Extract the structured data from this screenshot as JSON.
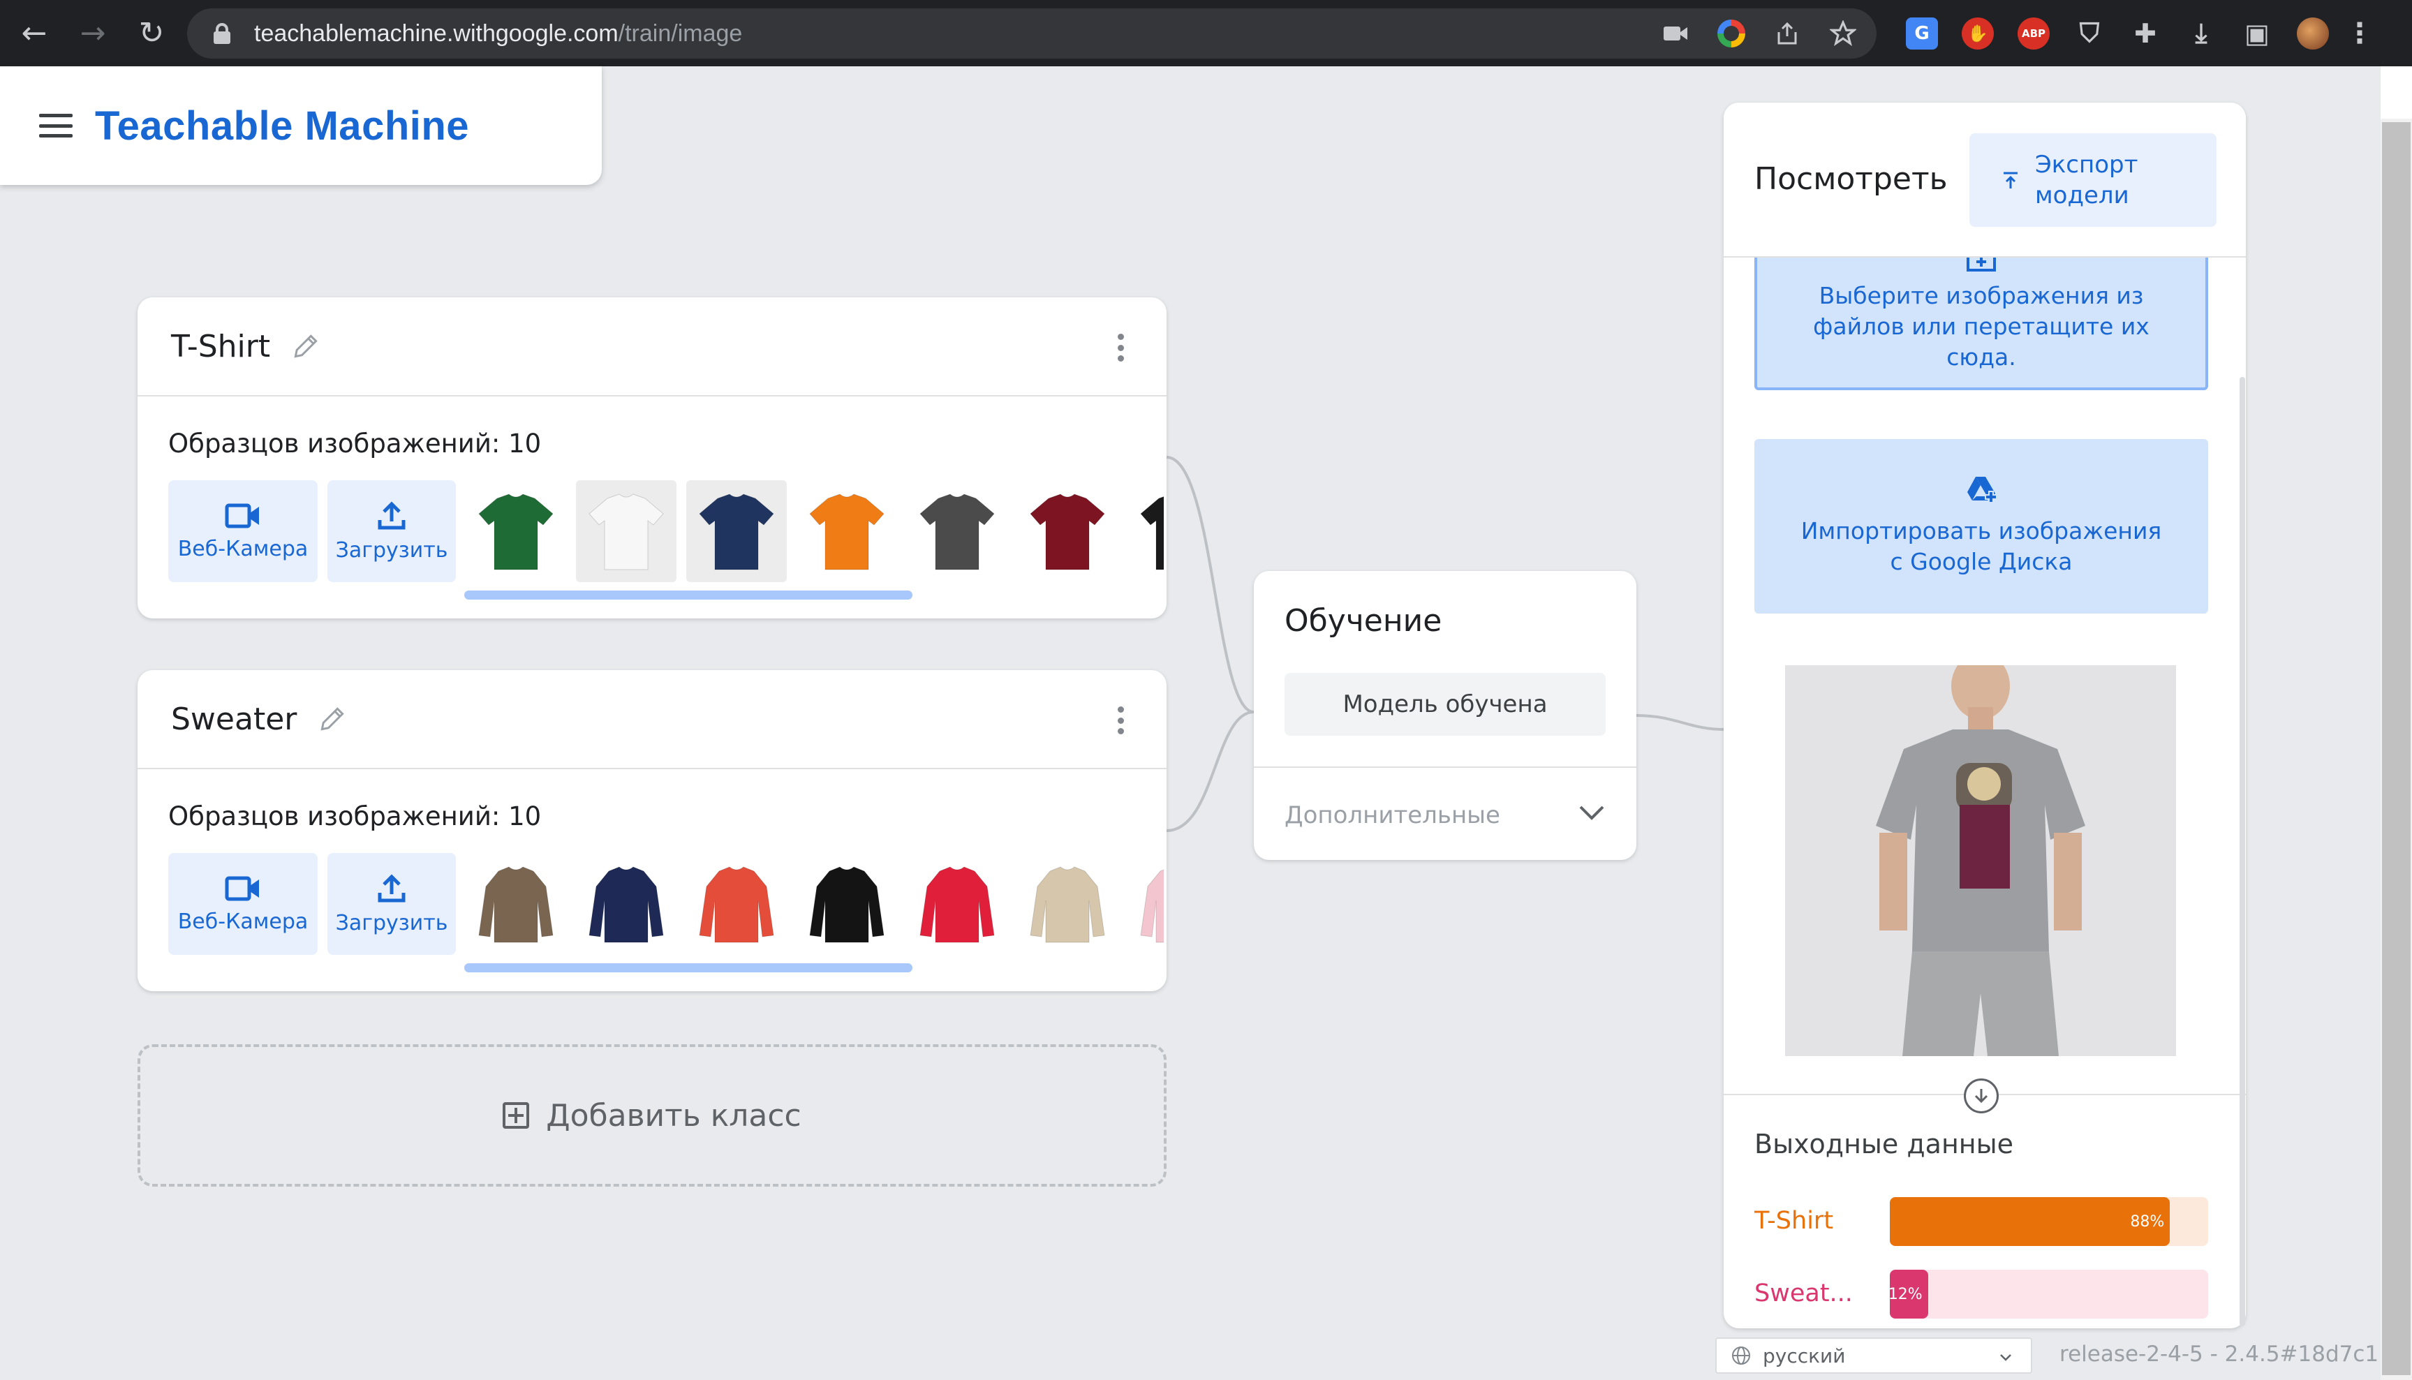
{
  "browser": {
    "url_host": "teachablemachine.withgoogle.com",
    "url_path": "/train/image",
    "nav": {
      "back": "←",
      "forward": "→",
      "reload": "↻"
    }
  },
  "app": {
    "title": "Teachable Machine"
  },
  "classes": [
    {
      "name": "T-Shirt",
      "samples_label": "Образцов изображений: 10",
      "webcam_label": "Веб-Камера",
      "upload_label": "Загрузить",
      "thumb_colors": [
        "#1f6b35",
        "#f7f7f7",
        "#1f3560",
        "#f07c16",
        "#4b4b4b",
        "#7d1421",
        "#1a1a1a"
      ]
    },
    {
      "name": "Sweater",
      "samples_label": "Образцов изображений: 10",
      "webcam_label": "Веб-Камера",
      "upload_label": "Загрузить",
      "thumb_colors": [
        "#7a6650",
        "#1e2a55",
        "#e44d3a",
        "#141414",
        "#e0203a",
        "#d6c6ac",
        "#f3c6cf"
      ]
    }
  ],
  "add_class_label": "Добавить класс",
  "training": {
    "title": "Обучение",
    "button_label": "Модель обучена",
    "advanced_label": "Дополнительные"
  },
  "preview": {
    "title": "Посмотреть",
    "export_label_line1": "Экспорт",
    "export_label_line2": "модели",
    "drop_line1": "Выберите изображения из",
    "drop_line2": "файлов или перетащите их",
    "drop_line3": "сюда.",
    "drive_line1": "Импортировать изображения",
    "drive_line2": "с Google Диска",
    "output_title": "Выходные данные",
    "outputs": [
      {
        "label": "T-Shirt",
        "percent_text": "88%",
        "value": 0.88,
        "color": "#e8710a",
        "track": "#fde9dc"
      },
      {
        "label": "Sweat...",
        "percent_text": "12%",
        "value": 0.12,
        "color": "#d9376e",
        "track": "#fde3ea"
      }
    ]
  },
  "footer": {
    "language": "русский",
    "version": "release-2-4-5 - 2.4.5#18d7c1"
  }
}
